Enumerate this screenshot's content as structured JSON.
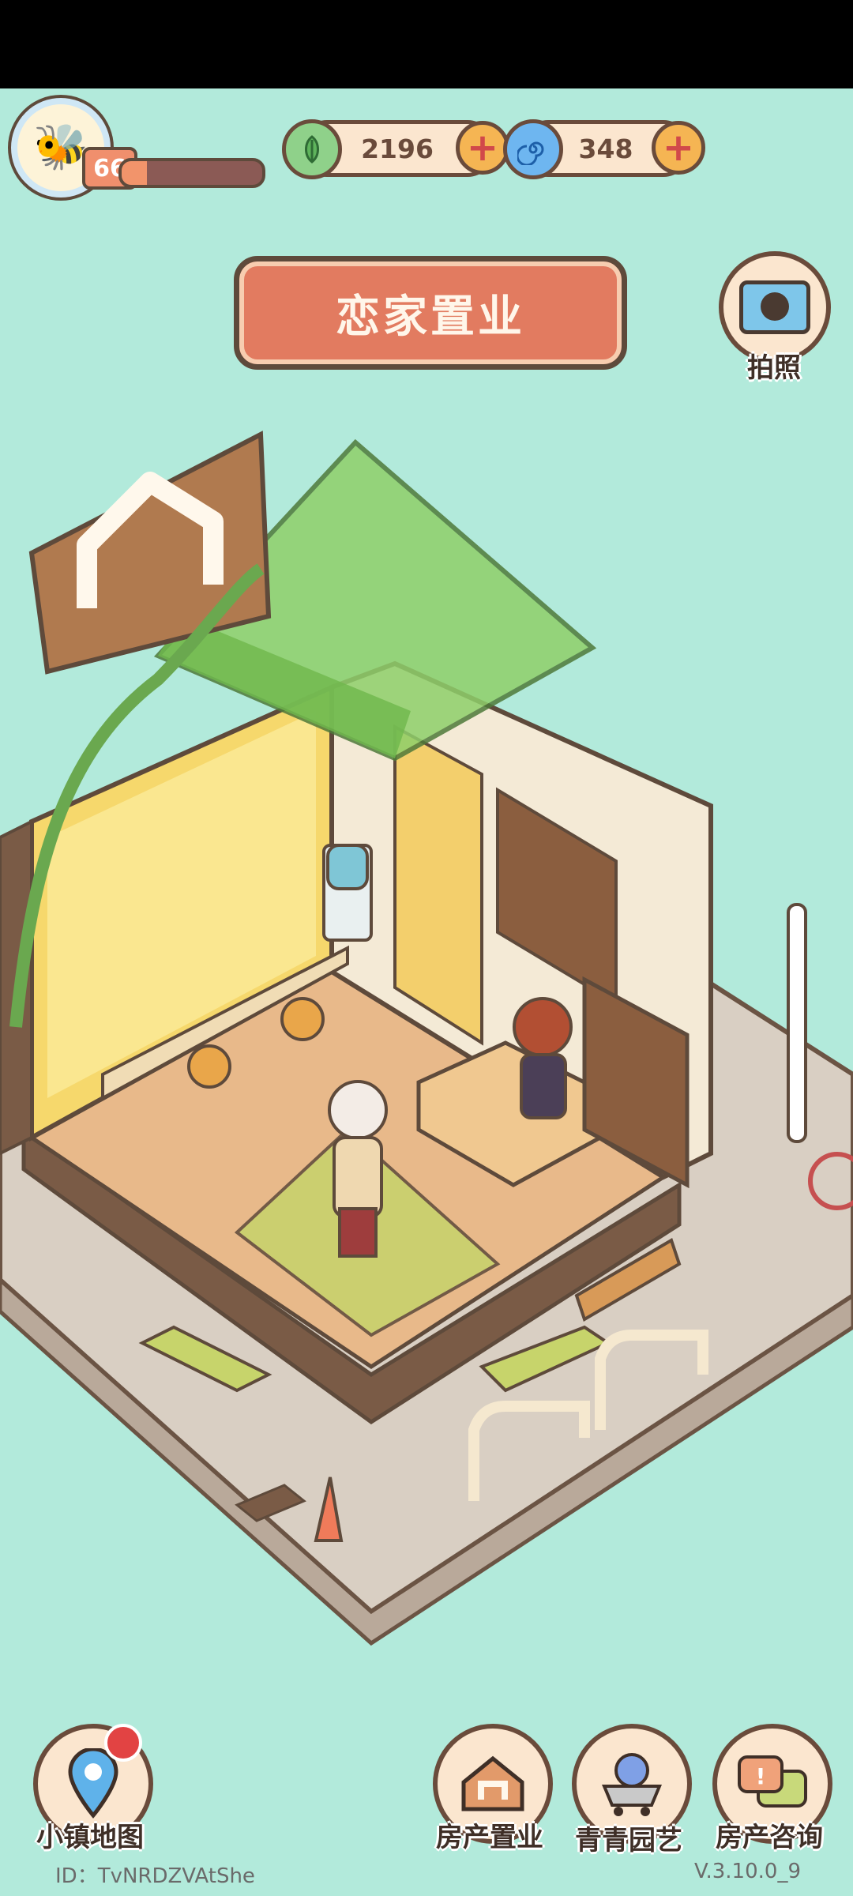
{
  "player": {
    "level": "66",
    "xp_progress_percent": 18
  },
  "currencies": [
    {
      "name": "leaf-coin",
      "value": "2196",
      "icon": "leaf-icon"
    },
    {
      "name": "blue-gem",
      "value": "348",
      "icon": "spiral-icon"
    }
  ],
  "title": "恋家置业",
  "camera": {
    "label": "拍照"
  },
  "bottom_nav": [
    {
      "label": "小镇地图",
      "icon": "map-pin-icon"
    },
    {
      "label": "房产置业",
      "icon": "house-icon"
    },
    {
      "label": "青青园艺",
      "icon": "flower-cart-icon"
    },
    {
      "label": "房产咨询",
      "icon": "chat-house-icon"
    }
  ],
  "footer": {
    "id": "ID：TvNRDZVAtShe",
    "version": "V.3.10.0_9"
  }
}
